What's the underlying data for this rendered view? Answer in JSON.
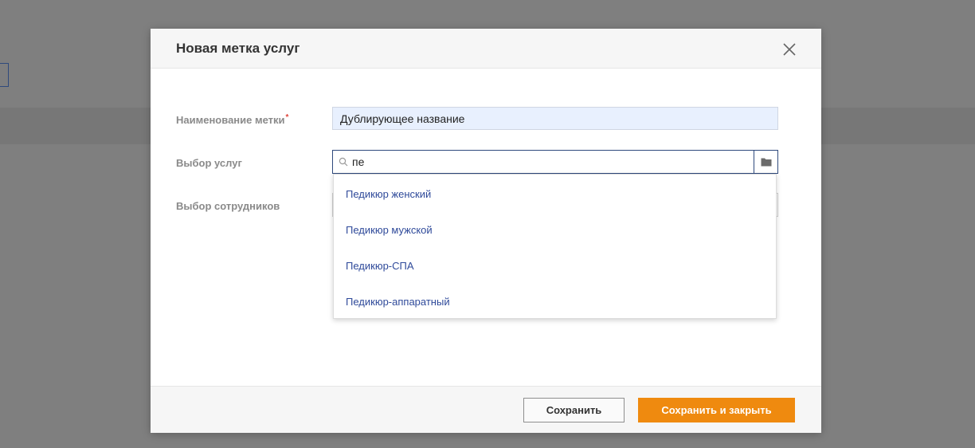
{
  "modal": {
    "title": "Новая метка услуг"
  },
  "form": {
    "name_label": "Наименование метки",
    "required_mark": "*",
    "name_value": "Дублирующее название",
    "services_label": "Выбор услуг",
    "services_query": "пе",
    "staff_label": "Выбор сотрудников"
  },
  "dropdown": {
    "items": [
      {
        "label": "Педикюр женский"
      },
      {
        "label": "Педикюр мужской"
      },
      {
        "label": "Педикюр-СПА"
      },
      {
        "label": "Педикюр-аппаратный"
      }
    ]
  },
  "footer": {
    "save_label": "Сохранить",
    "save_close_label": "Сохранить и закрыть"
  },
  "icons": {
    "close": "close-icon",
    "search": "search-icon",
    "folder": "folder-icon"
  },
  "colors": {
    "accent": "#ef8a0f",
    "link": "#2f4a9a",
    "focus_border": "#2f4a7d",
    "required": "#e0443a"
  }
}
